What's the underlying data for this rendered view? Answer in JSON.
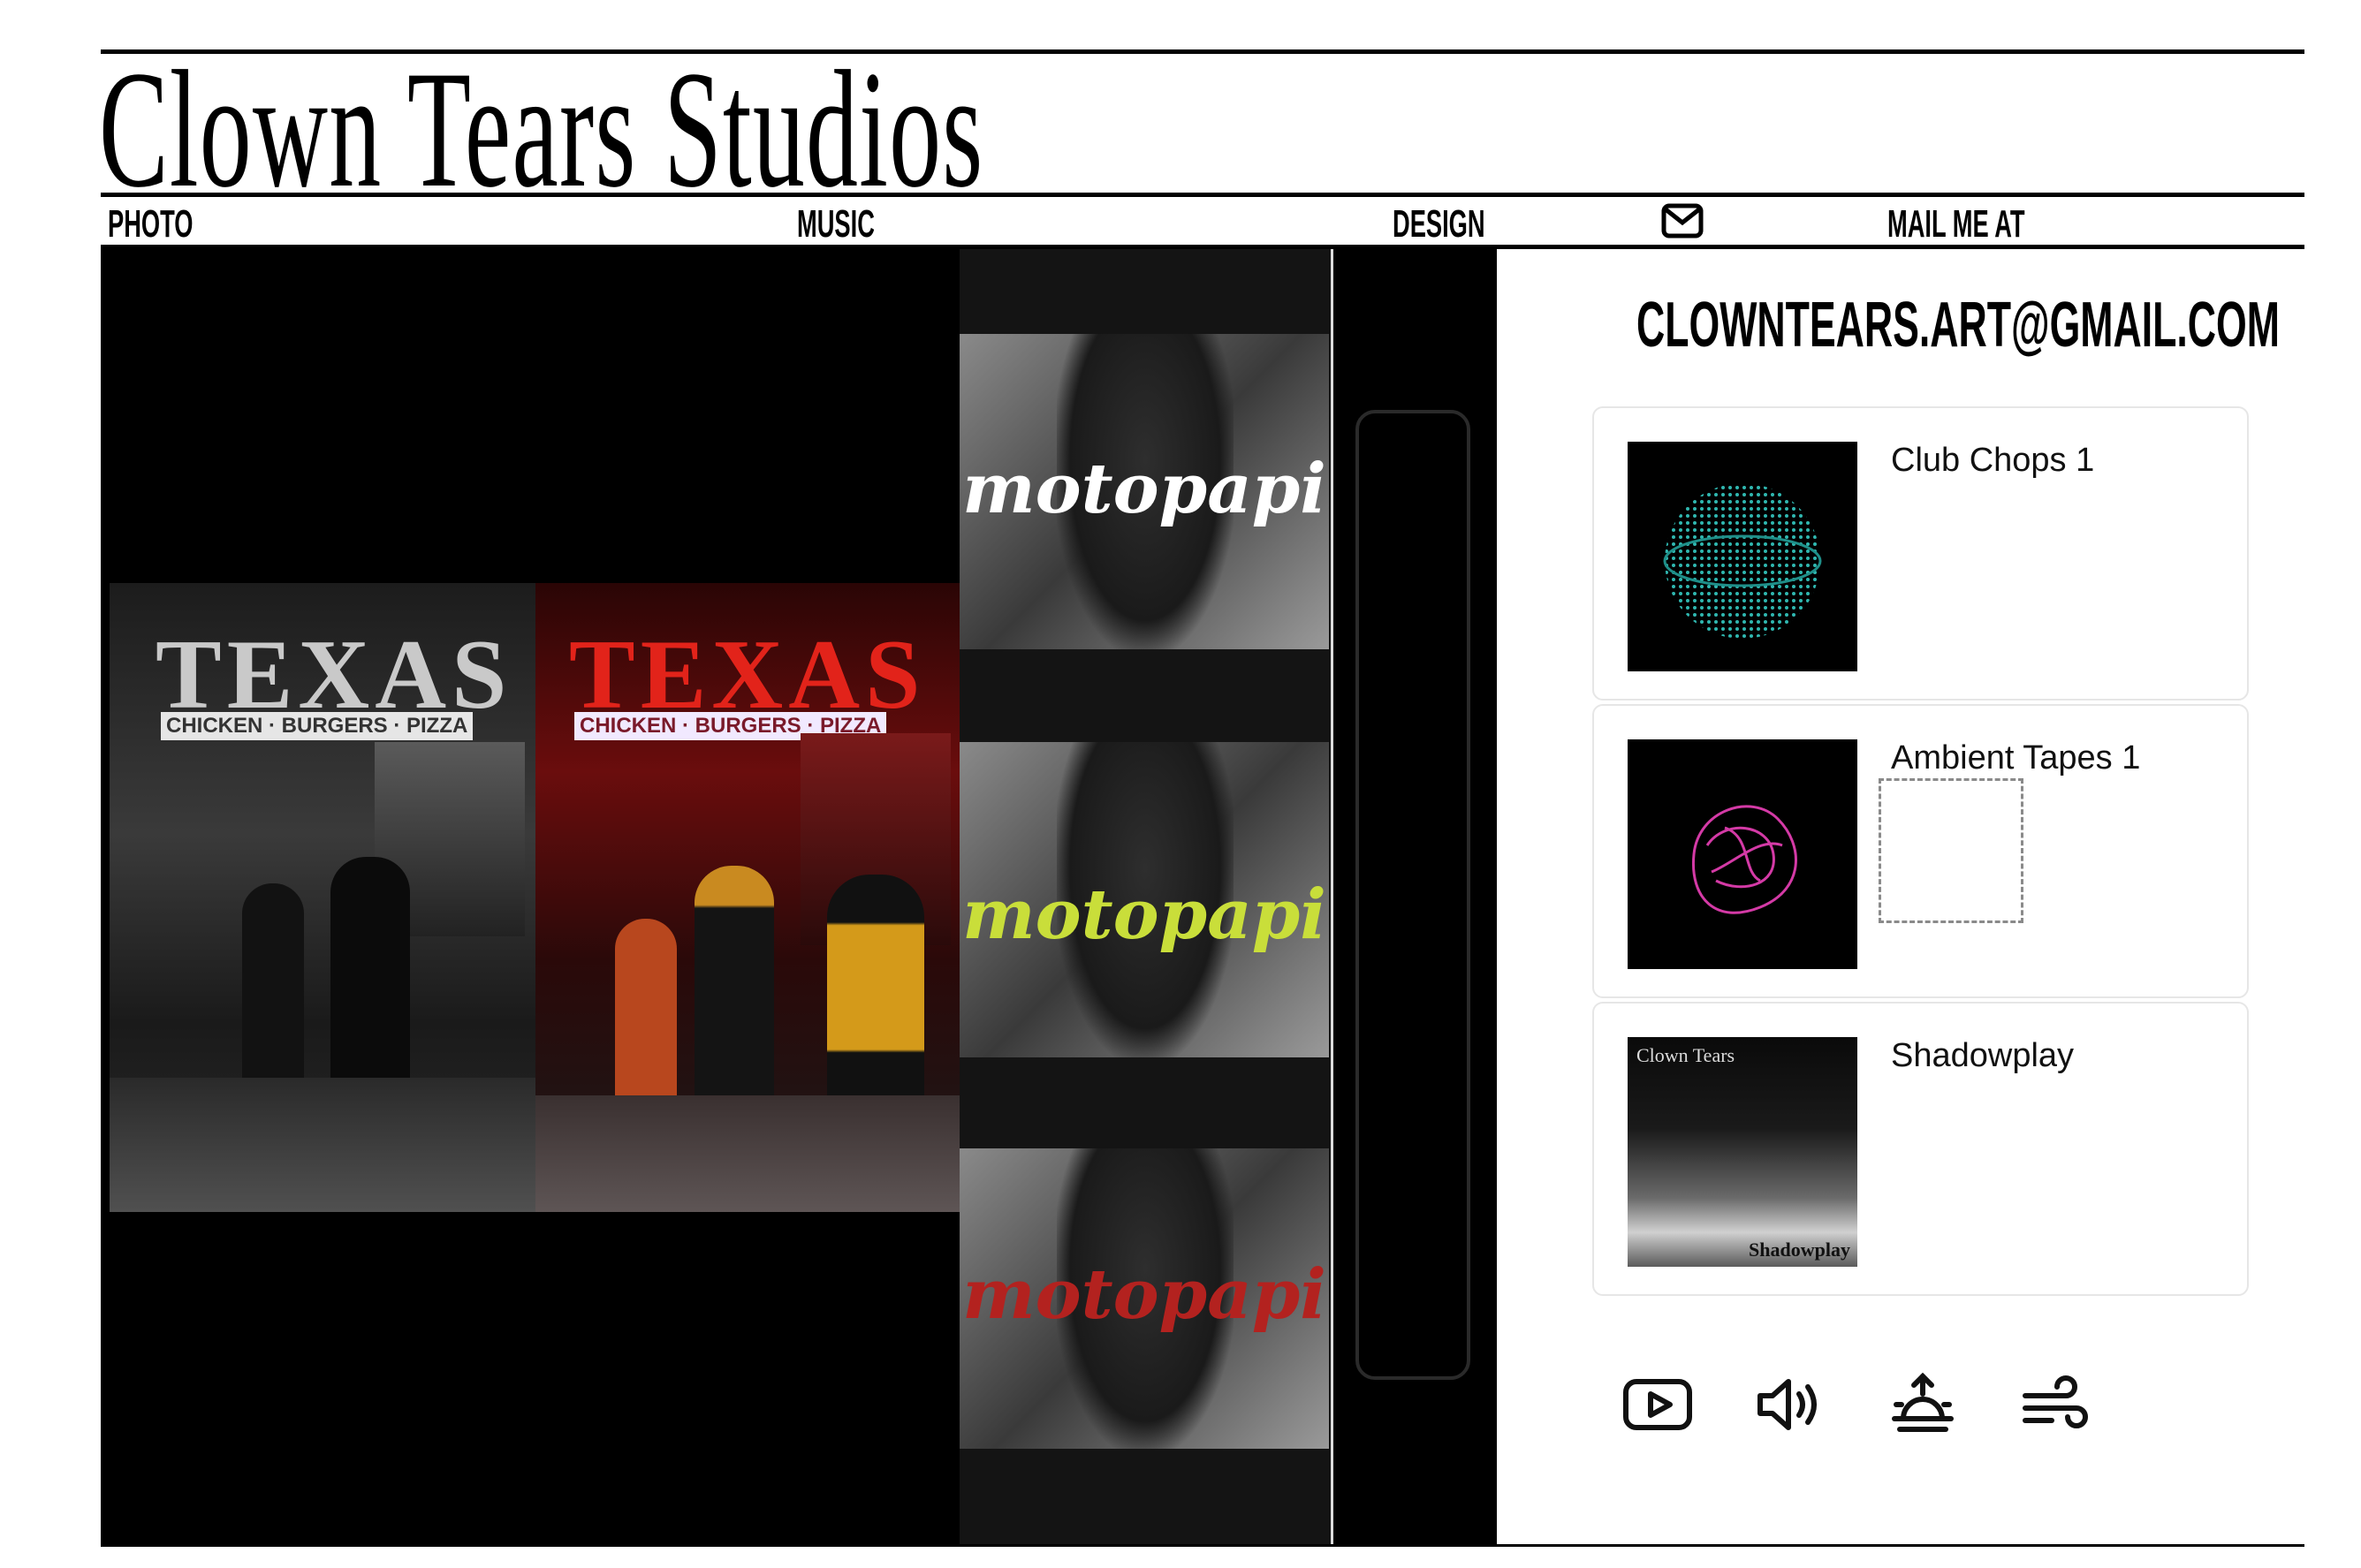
{
  "site": {
    "title": "Clown Tears Studios"
  },
  "nav": {
    "photo": "PHOTO",
    "music": "MUSIC",
    "design": "DESIGN",
    "mail_icon": "mail-icon",
    "mail_me": "MAIL ME AT"
  },
  "contact": {
    "email": "CLOWNTEARS.ART@GMAIL.COM"
  },
  "photo_panel": {
    "left_sign": {
      "main": "TEXAS",
      "sub": "CHICKEN · BURGERS · PIZZA"
    },
    "right_sign": {
      "main": "TEXAS",
      "sub": "CHICKEN · BURGERS · PIZZA"
    }
  },
  "design_panel": {
    "posters": [
      {
        "text": "motopapi",
        "color": "#ffffff"
      },
      {
        "text": "motopapi",
        "color": "#c9de3a"
      },
      {
        "text": "motopapi",
        "color": "#b3221f"
      }
    ]
  },
  "music": {
    "tracks": [
      {
        "title": "Club Chops 1",
        "art": "teal-sphere"
      },
      {
        "title": "Ambient Tapes  1",
        "art": "magenta-blob"
      },
      {
        "title": "Shadowplay",
        "art": "wave-photo",
        "art_text_top": "Clown Tears",
        "art_text_bottom": "Shadowplay"
      }
    ]
  },
  "controls": {
    "icons": [
      "youtube-icon",
      "volume-icon",
      "sunrise-icon",
      "wind-icon"
    ]
  },
  "colors": {
    "accent_teal": "#2fb7b0",
    "accent_magenta": "#d43aa6",
    "ink": "#000000"
  }
}
